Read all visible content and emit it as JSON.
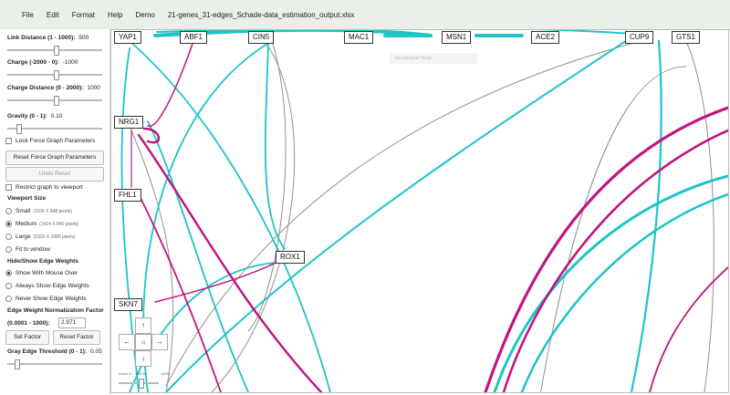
{
  "menu": {
    "items": [
      "File",
      "Edit",
      "Format",
      "Help",
      "Demo"
    ],
    "filename": "21-genes_31-edges_Schade-data_estimation_output.xlsx"
  },
  "sidebar": {
    "link_distance": {
      "label": "Link Distance (1 - 1000):",
      "value": "500"
    },
    "charge": {
      "label": "Charge (-2000 - 0):",
      "value": "-1000"
    },
    "charge_distance": {
      "label": "Charge Distance (0 - 2000):",
      "value": "1000"
    },
    "gravity": {
      "label": "Gravity (0 - 1):",
      "value": "0.10"
    },
    "lock_label": "Lock Force Graph Parameters",
    "reset_button": "Reset Force Graph Parameters",
    "undo_button": "Undo Reset",
    "restrict_label": "Restrict graph to viewport",
    "viewport_title": "Viewport Size",
    "viewport_options": [
      {
        "label": "Small",
        "size": "(1104 X 648 pixels)"
      },
      {
        "label": "Medium",
        "size": "(1414 X 840 pixels)"
      },
      {
        "label": "Large",
        "size": "(1920 X 1080 pixels)"
      },
      {
        "label": "Fit to window",
        "size": ""
      }
    ],
    "viewport_selected": "Medium",
    "weights_title": "Hide/Show Edge Weights",
    "weights_options": [
      "Show With Mouse Over",
      "Always Show Edge Weights",
      "Never Show Edge Weights"
    ],
    "weights_selected": "Show With Mouse Over",
    "norm_label": "Edge Weight Normalization Factor",
    "norm_range": "(0.0001 - 1000):",
    "norm_value": "2.971",
    "set_factor": "Set Factor",
    "reset_factor": "Reset Factor",
    "gray_threshold": {
      "label": "Gray Edge Threshold (0 - 1):",
      "value": "0.05"
    }
  },
  "graph": {
    "nodes": [
      "YAP1",
      "ABF1",
      "CIN5",
      "MAC1",
      "MSN1",
      "ACE2",
      "CUP9",
      "GTS1",
      "NRG1",
      "FHL1",
      "ROX1",
      "SKN7"
    ],
    "zoom_label": "Zoom (1 - 200%):",
    "zoom_value": "100%",
    "tooltip": "Rectangular Node"
  },
  "colors": {
    "cyan": "#1dc4c8",
    "magenta": "#c0157f",
    "gray": "#909090",
    "menubar": "#e9f0ea"
  }
}
